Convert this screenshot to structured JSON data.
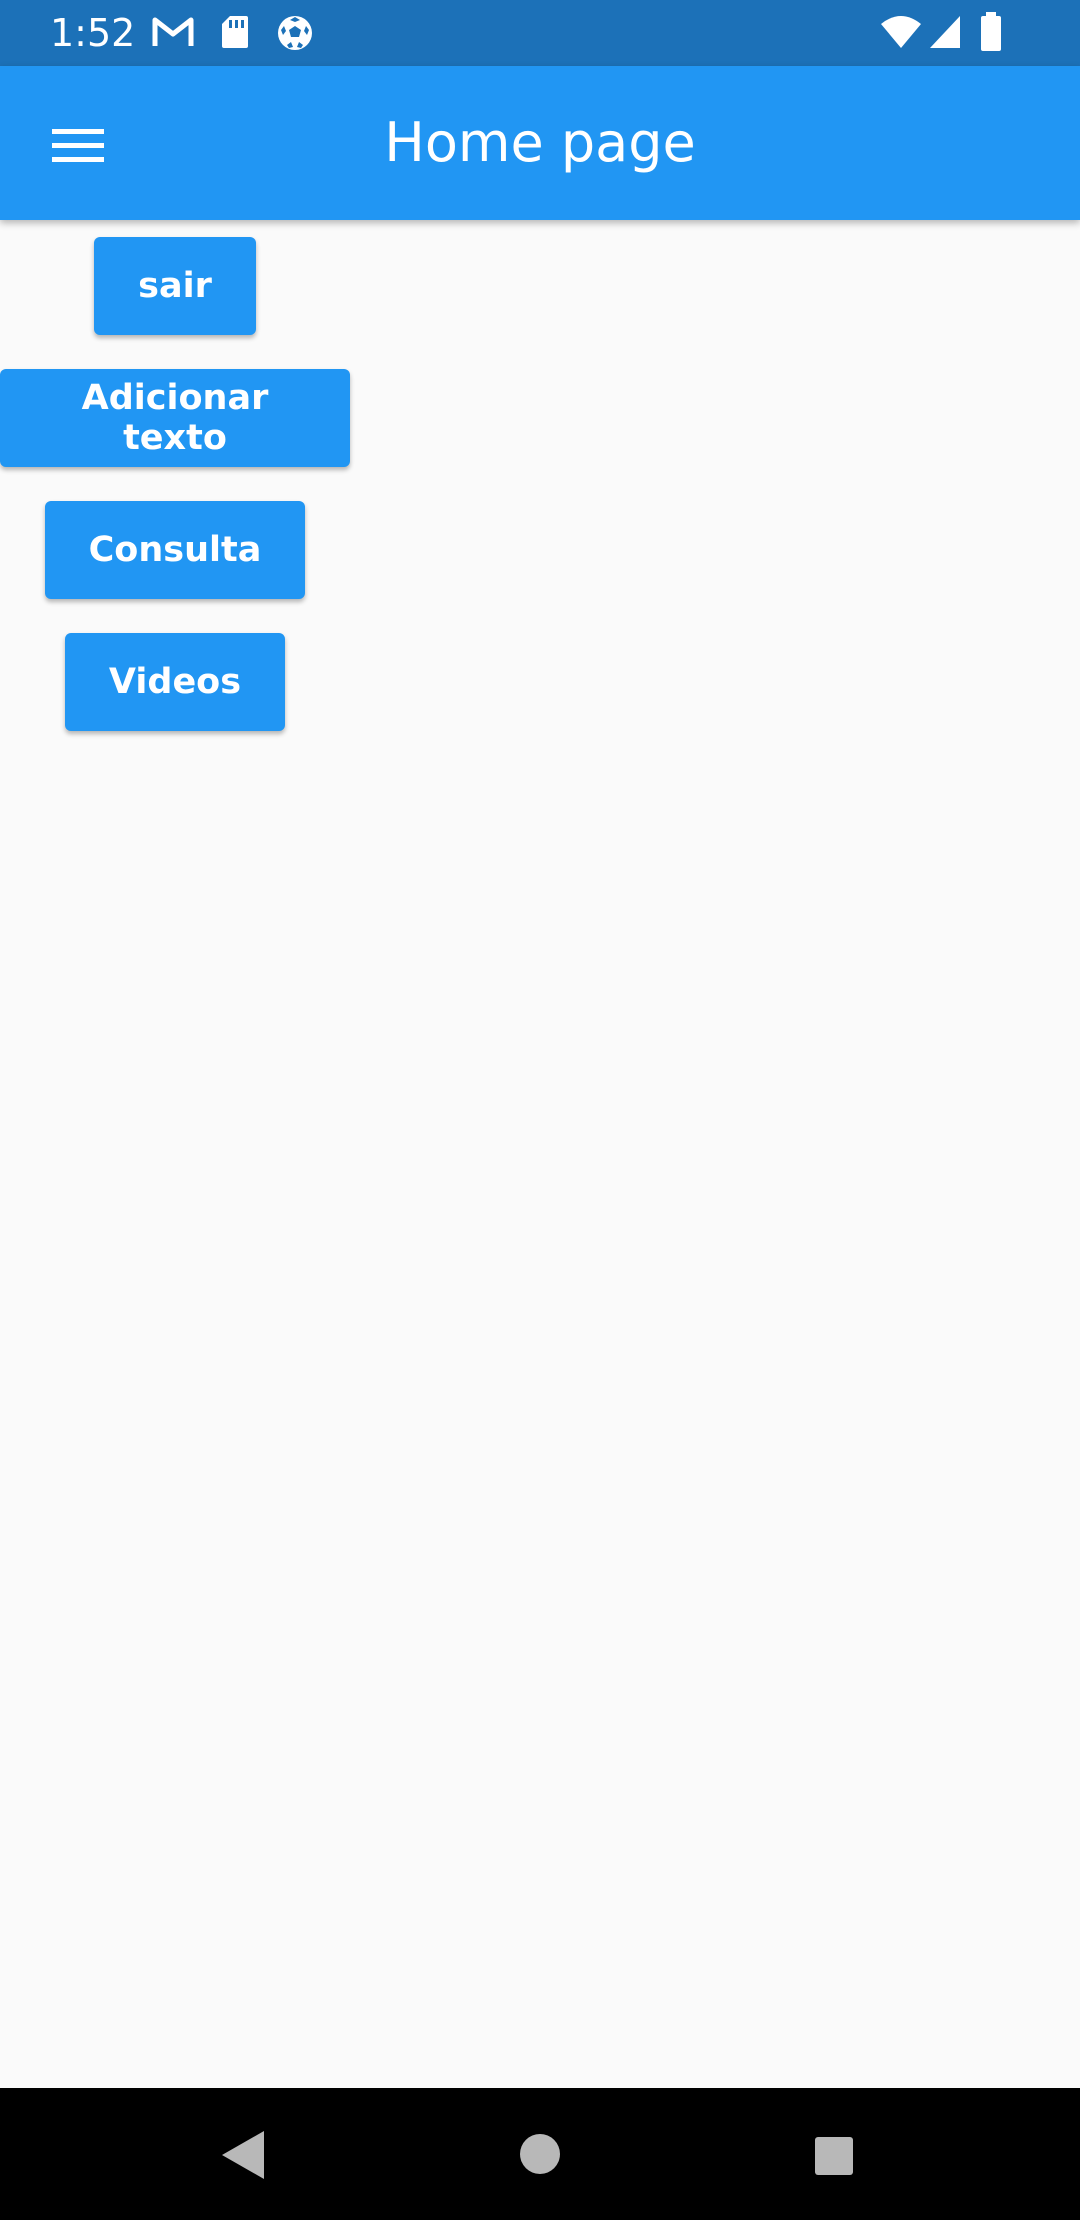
{
  "status_bar": {
    "time": "1:52",
    "icons": [
      "gmail-icon",
      "sd-card-icon",
      "soccer-ball-icon",
      "wifi-icon",
      "signal-icon",
      "battery-icon"
    ]
  },
  "app_bar": {
    "title": "Home page",
    "menu_icon": "hamburger-menu-icon"
  },
  "buttons": [
    {
      "label": "sair"
    },
    {
      "label": "Adicionar texto"
    },
    {
      "label": "Consulta"
    },
    {
      "label": "Videos"
    }
  ],
  "nav_bar": {
    "icons": [
      "back-icon",
      "home-icon",
      "recents-icon"
    ]
  },
  "colors": {
    "status_bar": "#1c71b8",
    "app_bar": "#2196f3",
    "button": "#2196f3",
    "background": "#fafafa",
    "nav_bar": "#000000"
  }
}
